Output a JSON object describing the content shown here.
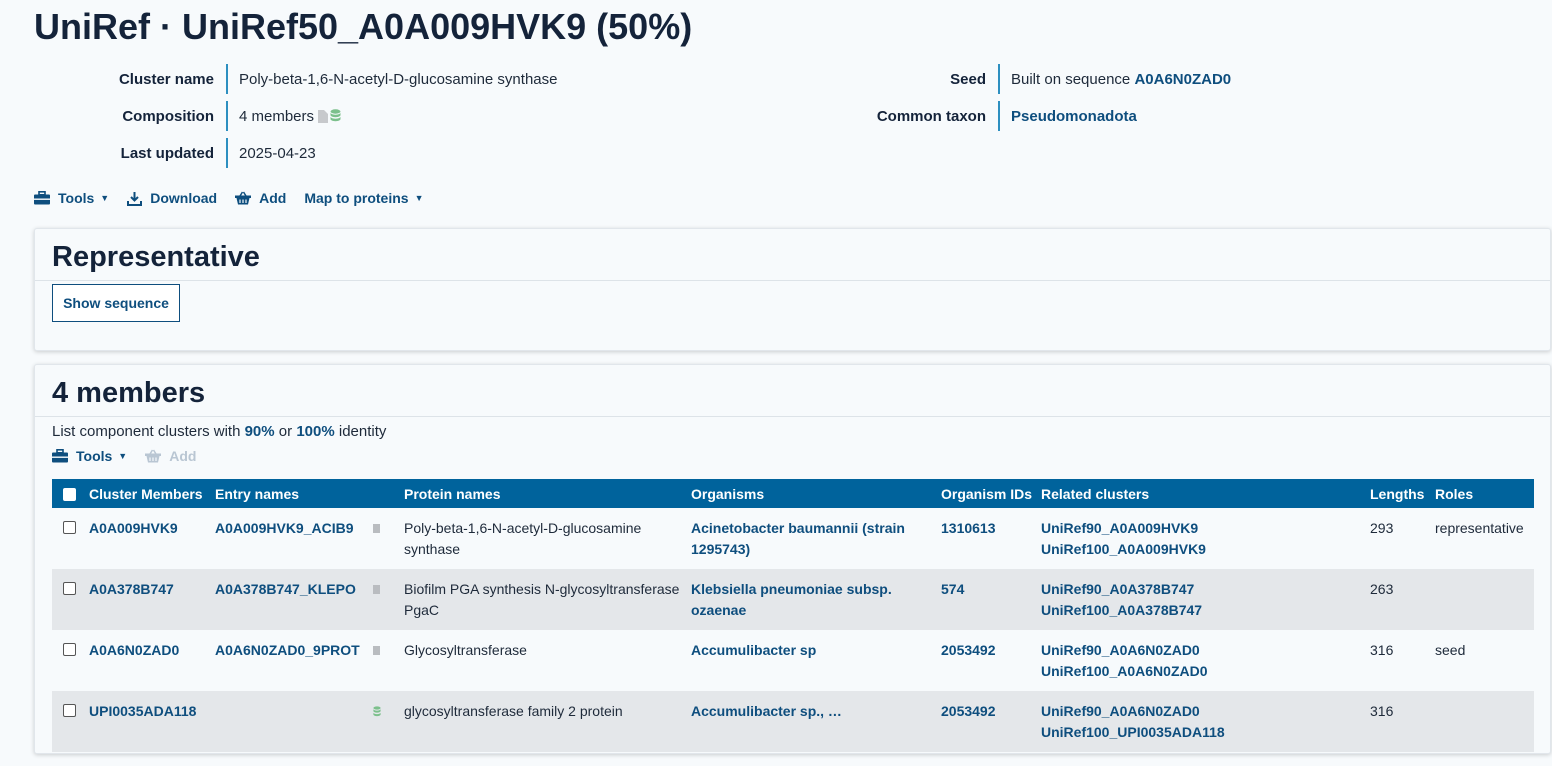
{
  "page": {
    "title": "UniRef · UniRef50_A0A009HVK9 (50%)"
  },
  "info": {
    "cluster_name_label": "Cluster name",
    "cluster_name": "Poly-beta-1,6-N-acetyl-D-glucosamine synthase",
    "composition_label": "Composition",
    "composition": "4 members",
    "last_updated_label": "Last updated",
    "last_updated": "2025-04-23",
    "seed_label": "Seed",
    "seed_prefix": "Built on sequence",
    "seed_link": "A0A6N0ZAD0",
    "common_taxon_label": "Common taxon",
    "common_taxon": "Pseudomonadota"
  },
  "toolbar": {
    "tools": "Tools",
    "download": "Download",
    "add": "Add",
    "map": "Map to proteins"
  },
  "representative": {
    "title": "Representative",
    "show_sequence": "Show sequence"
  },
  "members": {
    "title": "4 members",
    "sub_prefix": "List component clusters with",
    "sub_90": "90%",
    "sub_or": "or",
    "sub_100": "100%",
    "sub_suffix": "identity",
    "tools": "Tools",
    "add": "Add",
    "columns": [
      "Cluster Members",
      "Entry names",
      "Protein names",
      "Organisms",
      "Organism IDs",
      "Related clusters",
      "Lengths",
      "Roles"
    ],
    "rows": [
      {
        "member": "A0A009HVK9",
        "entry": "A0A009HVK9_ACIB9",
        "icon": "document-icon",
        "protein": "Poly-beta-1,6-N-acetyl-D-glucosamine synthase",
        "organism": "Acinetobacter baumannii (strain 1295743)",
        "org_id": "1310613",
        "rel90": "UniRef90_A0A009HVK9",
        "rel100": "UniRef100_A0A009HVK9",
        "length": "293",
        "role": "representative"
      },
      {
        "member": "A0A378B747",
        "entry": "A0A378B747_KLEPO",
        "icon": "document-icon",
        "protein": "Biofilm PGA synthesis N-glycosyltransferase PgaC",
        "organism": "Klebsiella pneumoniae subsp. ozaenae",
        "org_id": "574",
        "rel90": "UniRef90_A0A378B747",
        "rel100": "UniRef100_A0A378B747",
        "length": "263",
        "role": ""
      },
      {
        "member": "A0A6N0ZAD0",
        "entry": "A0A6N0ZAD0_9PROT",
        "icon": "document-icon",
        "protein": "Glycosyltransferase",
        "organism": "Accumulibacter sp",
        "org_id": "2053492",
        "rel90": "UniRef90_A0A6N0ZAD0",
        "rel100": "UniRef100_A0A6N0ZAD0",
        "length": "316",
        "role": "seed"
      },
      {
        "member": "UPI0035ADA118",
        "entry": "",
        "icon": "database-icon",
        "protein": "glycosyltransferase family 2 protein",
        "organism": "Accumulibacter sp., …",
        "org_id": "2053492",
        "rel90": "UniRef90_A0A6N0ZAD0",
        "rel100": "UniRef100_UPI0035ADA118",
        "length": "316",
        "role": ""
      }
    ]
  },
  "colors": {
    "header_bg": "#00639c",
    "link": "#0e4e7e",
    "accent_bar": "#2d8fc0"
  }
}
